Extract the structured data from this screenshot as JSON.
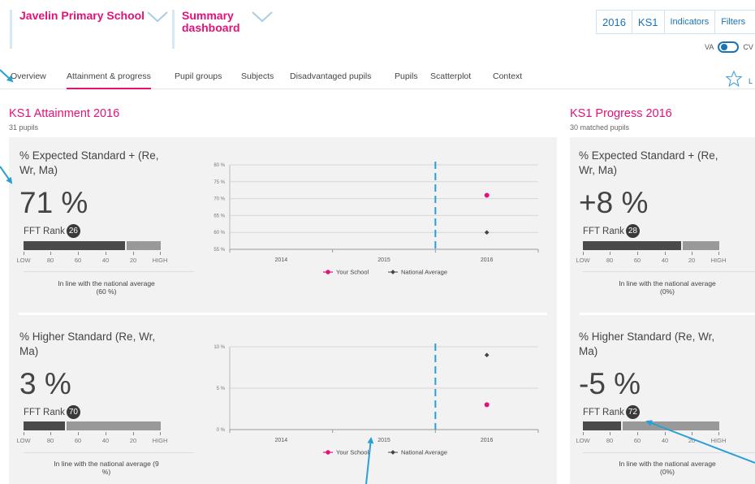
{
  "header": {
    "school": "Javelin Primary School",
    "dashboard": "Summary dashboard",
    "tabs": [
      "2016",
      "KS1",
      "Indicators",
      "Filters"
    ],
    "toggle_left": "VA",
    "toggle_right": "CV"
  },
  "nav": {
    "items": [
      "Overview",
      "Attainment & progress",
      "Pupil groups",
      "Subjects",
      "Disadvantaged pupils",
      "Pupils",
      "Scatterplot",
      "Context"
    ],
    "active_index": 1,
    "star_label": "L"
  },
  "attainment": {
    "title": "KS1 Attainment 2016",
    "subtitle": "31 pupils",
    "metrics": [
      {
        "title": "% Expected Standard + (Re, Wr, Ma)",
        "value": "71 %",
        "rank_label": "FFT Rank",
        "rank": "26",
        "rank_fill_fraction": 0.74,
        "status": "In line with the national average (60 %)"
      },
      {
        "title": "% Higher Standard (Re, Wr, Ma)",
        "value": "3 %",
        "rank_label": "FFT Rank",
        "rank": "70",
        "rank_fill_fraction": 0.3,
        "status": "In line with the national average (9 %)"
      }
    ]
  },
  "progress": {
    "title": "KS1 Progress 2016",
    "subtitle": "30 matched pupils",
    "metrics": [
      {
        "title": "% Expected Standard + (Re, Wr, Ma)",
        "value": "+8 %",
        "rank_label": "FFT Rank",
        "rank": "28",
        "rank_fill_fraction": 0.72,
        "status": "In line with the national average (0%)"
      },
      {
        "title": "% Higher Standard (Re, Wr, Ma)",
        "value": "-5 %",
        "rank_label": "FFT Rank",
        "rank": "72",
        "rank_fill_fraction": 0.28,
        "status": "In line with the national average (0%)"
      }
    ]
  },
  "scale_labels": [
    "LOW",
    "80",
    "60",
    "40",
    "20",
    "HIGH"
  ],
  "chart_data": [
    {
      "type": "scatter",
      "x": [
        "2014",
        "2015",
        "2016"
      ],
      "yticks": [
        55,
        60,
        65,
        70,
        75,
        80
      ],
      "ytick_labels": [
        "55 %",
        "60 %",
        "65 %",
        "70 %",
        "75 %",
        "80 %"
      ],
      "ylim": [
        55,
        80
      ],
      "marker_line_x": 2015.5,
      "series": [
        {
          "name": "Your School",
          "color": "#e2127a",
          "points": [
            {
              "x": "2016",
              "y": 71
            }
          ]
        },
        {
          "name": "National Average",
          "color": "#444444",
          "points": [
            {
              "x": "2016",
              "y": 60
            }
          ]
        }
      ],
      "legend": "bottom"
    },
    {
      "type": "scatter",
      "x": [
        "2014",
        "2015",
        "2016"
      ],
      "yticks": [
        0,
        5,
        10
      ],
      "ytick_labels": [
        "0 %",
        "5 %",
        "10 %"
      ],
      "ylim": [
        0,
        10
      ],
      "marker_line_x": 2015.5,
      "series": [
        {
          "name": "Your School",
          "color": "#e2127a",
          "points": [
            {
              "x": "2016",
              "y": 3
            }
          ]
        },
        {
          "name": "National Average",
          "color": "#444444",
          "points": [
            {
              "x": "2016",
              "y": 9
            }
          ]
        }
      ],
      "legend": "bottom"
    }
  ],
  "colors": {
    "accent": "#e2127a",
    "link": "#1a73b5",
    "dashed": "#2a9fd6",
    "panel": "#f2f2f2"
  }
}
